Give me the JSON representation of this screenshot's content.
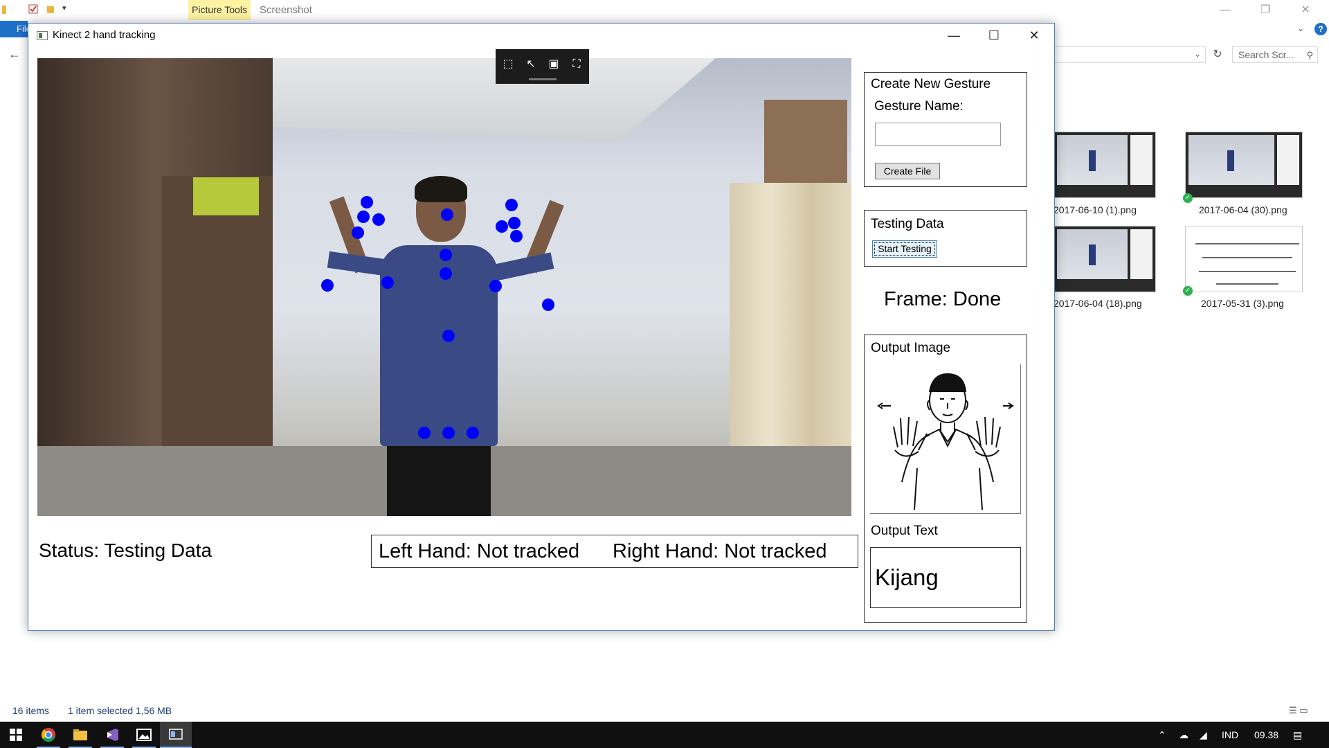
{
  "explorer": {
    "ribbon_tab_picture_tools": "Picture Tools",
    "ribbon_tab_screenshot": "Screenshot",
    "file_tab": "File",
    "search_placeholder": "Search Scr...",
    "thumbnails": [
      {
        "label": "2017-06-10 (1).png",
        "synced": false
      },
      {
        "label": "2017-06-04 (30).png",
        "synced": true
      },
      {
        "label": "2017-06-04 (18).png",
        "synced": false
      },
      {
        "label": "2017-05-31 (3).png",
        "synced": true
      }
    ],
    "status_items": "16 items",
    "status_selected": "1 item selected  1,56 MB"
  },
  "app": {
    "title": "Kinect 2 hand tracking",
    "create_gesture": {
      "heading": "Create New Gesture",
      "name_label": "Gesture Name:",
      "name_value": "",
      "button": "Create File"
    },
    "testing": {
      "heading": "Testing Data",
      "button": "Start Testing"
    },
    "frame_status": "Frame: Done",
    "output_image_heading": "Output Image",
    "output_text_heading": "Output Text",
    "output_text": "Kijang",
    "status": "Status: Testing Data",
    "left_hand": "Left Hand: Not tracked",
    "right_hand": "Right Hand: Not tracked"
  },
  "taskbar": {
    "language": "IND",
    "time": "09.38"
  },
  "colors": {
    "joint": "#0000ff",
    "accent": "#1e6fc8",
    "taskbar": "#101010"
  }
}
